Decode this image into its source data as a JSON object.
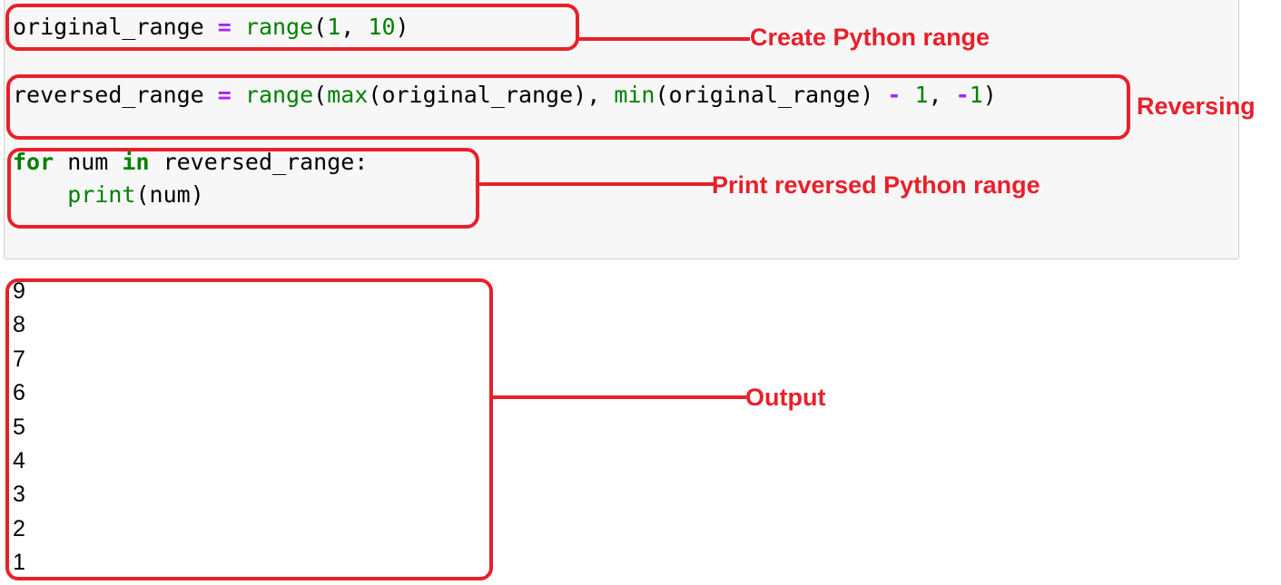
{
  "code": {
    "line1": {
      "var": "original_range",
      "eq": "=",
      "fn": "range",
      "open": "(",
      "a": "1",
      "comma": ", ",
      "b": "10",
      "close": ")"
    },
    "line2": {
      "var": "reversed_range",
      "eq": "=",
      "fn": "range",
      "open": "(",
      "max": "max",
      "p1": "(original_range), ",
      "min": "min",
      "p2": "(original_range) ",
      "minus": "-",
      "sp": " ",
      "one": "1",
      "comma": ", ",
      "neg": "-",
      "one2": "1",
      "close": ")"
    },
    "line3": {
      "kw_for": "for",
      "mid": " num ",
      "kw_in": "in",
      "rest": " reversed_range:"
    },
    "line4": {
      "indent": "    ",
      "fn": "print",
      "args": "(num)"
    }
  },
  "output": [
    "9",
    "8",
    "7",
    "6",
    "5",
    "4",
    "3",
    "2",
    "1"
  ],
  "annotations": {
    "create": "Create Python range",
    "reversing": "Reversing",
    "print": "Print reversed Python range",
    "output": "Output"
  },
  "colors": {
    "annotation": "#e8202a",
    "keyword": "#008000",
    "operator": "#aa22ff"
  }
}
